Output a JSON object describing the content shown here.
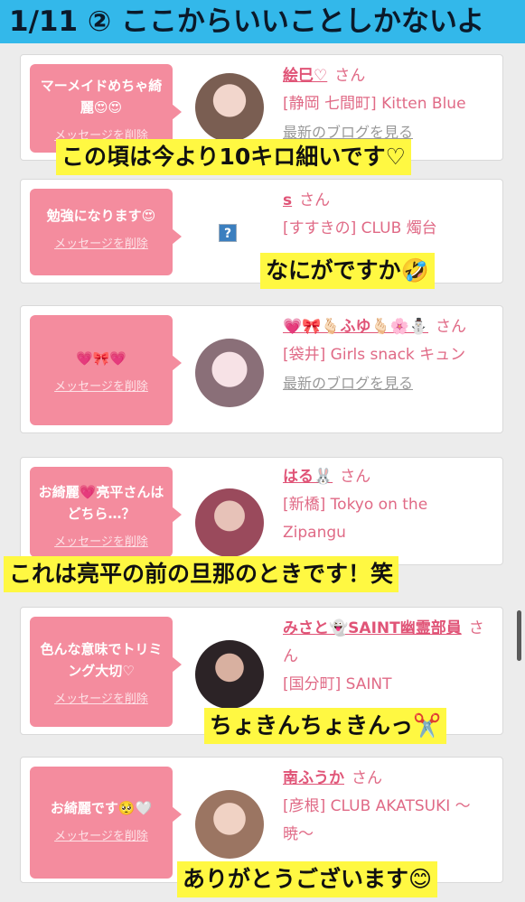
{
  "header": {
    "title": "1/11 ② ここからいいことしかないよ"
  },
  "delete_label": "メッセージを削除",
  "san": "さん",
  "blog_label": "最新のブログを見る",
  "cards": [
    {
      "message": "マーメイドめちゃ綺麗😍😍",
      "name": "絵巳♡",
      "shop": "[静岡 七間町] Kitten Blue"
    },
    {
      "message": "勉強になります😍",
      "name": "s",
      "shop": "[すすきの] CLUB 燭台"
    },
    {
      "message": "💗🎀💗",
      "name": "💗🎀🫰🏻ふゆ🫰🏻🌸⛄",
      "shop": "[袋井] Girls snack キュン"
    },
    {
      "message": "お綺麗💗亮平さんはどちら…？",
      "name": "はる🐰",
      "shop": "[新橋] Tokyo on the Zipangu"
    },
    {
      "message": "色んな意味でトリミング大切♡",
      "name": "みさと👻SAINT幽霊部員",
      "shop": "[国分町] SAINT"
    },
    {
      "message": "お綺麗です🥺🤍",
      "name": "南ふうか",
      "shop": "[彦根] CLUB AKATSUKI 〜暁〜"
    }
  ],
  "captions": [
    "この頃は今より10キロ細いです♡",
    "なにがですか🤣",
    "これは亮平の前の旦那のときです！笑",
    "ちょきんちょきんっ✂️",
    "ありがとうございます😊"
  ],
  "colors": {
    "header_bg": "#33b8ea",
    "bubble": "#f48c9e",
    "caption_bg": "#fff842",
    "name": "#e05477"
  }
}
